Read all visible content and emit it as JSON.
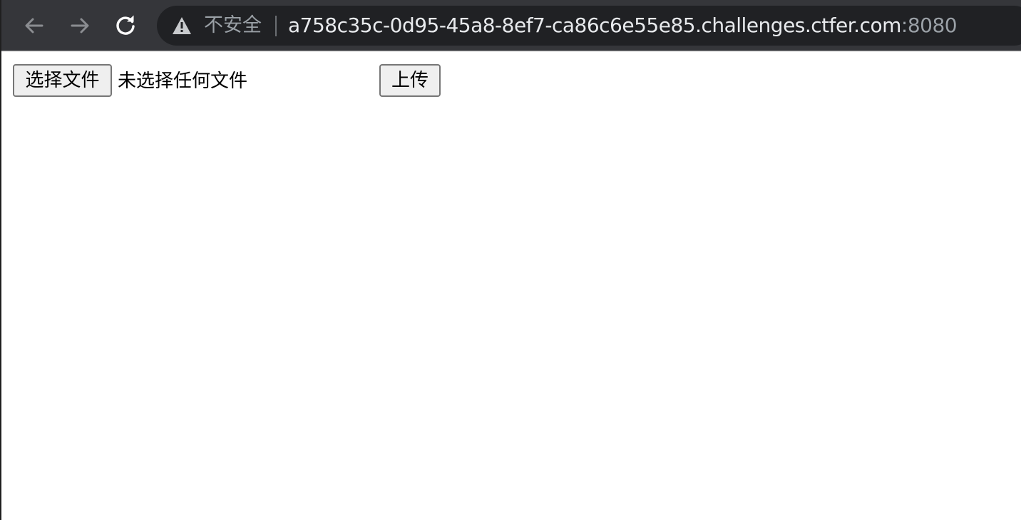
{
  "browser": {
    "back_icon": "arrow-left-icon",
    "forward_icon": "arrow-right-icon",
    "reload_icon": "reload-icon",
    "security_icon": "warning-triangle-icon",
    "security_label": "不安全",
    "url_host": "a758c35c-0d95-45a8-8ef7-ca86c6e55e85.challenges.ctfer.com",
    "url_port": ":8080",
    "colors": {
      "toolbar_bg": "#35363a",
      "omnibox_bg": "#202124",
      "url_text": "#e8eaed",
      "muted_text": "#9aa0a6"
    }
  },
  "page": {
    "choose_file_label": "选择文件",
    "no_file_label": "未选择任何文件",
    "upload_label": "上传"
  }
}
